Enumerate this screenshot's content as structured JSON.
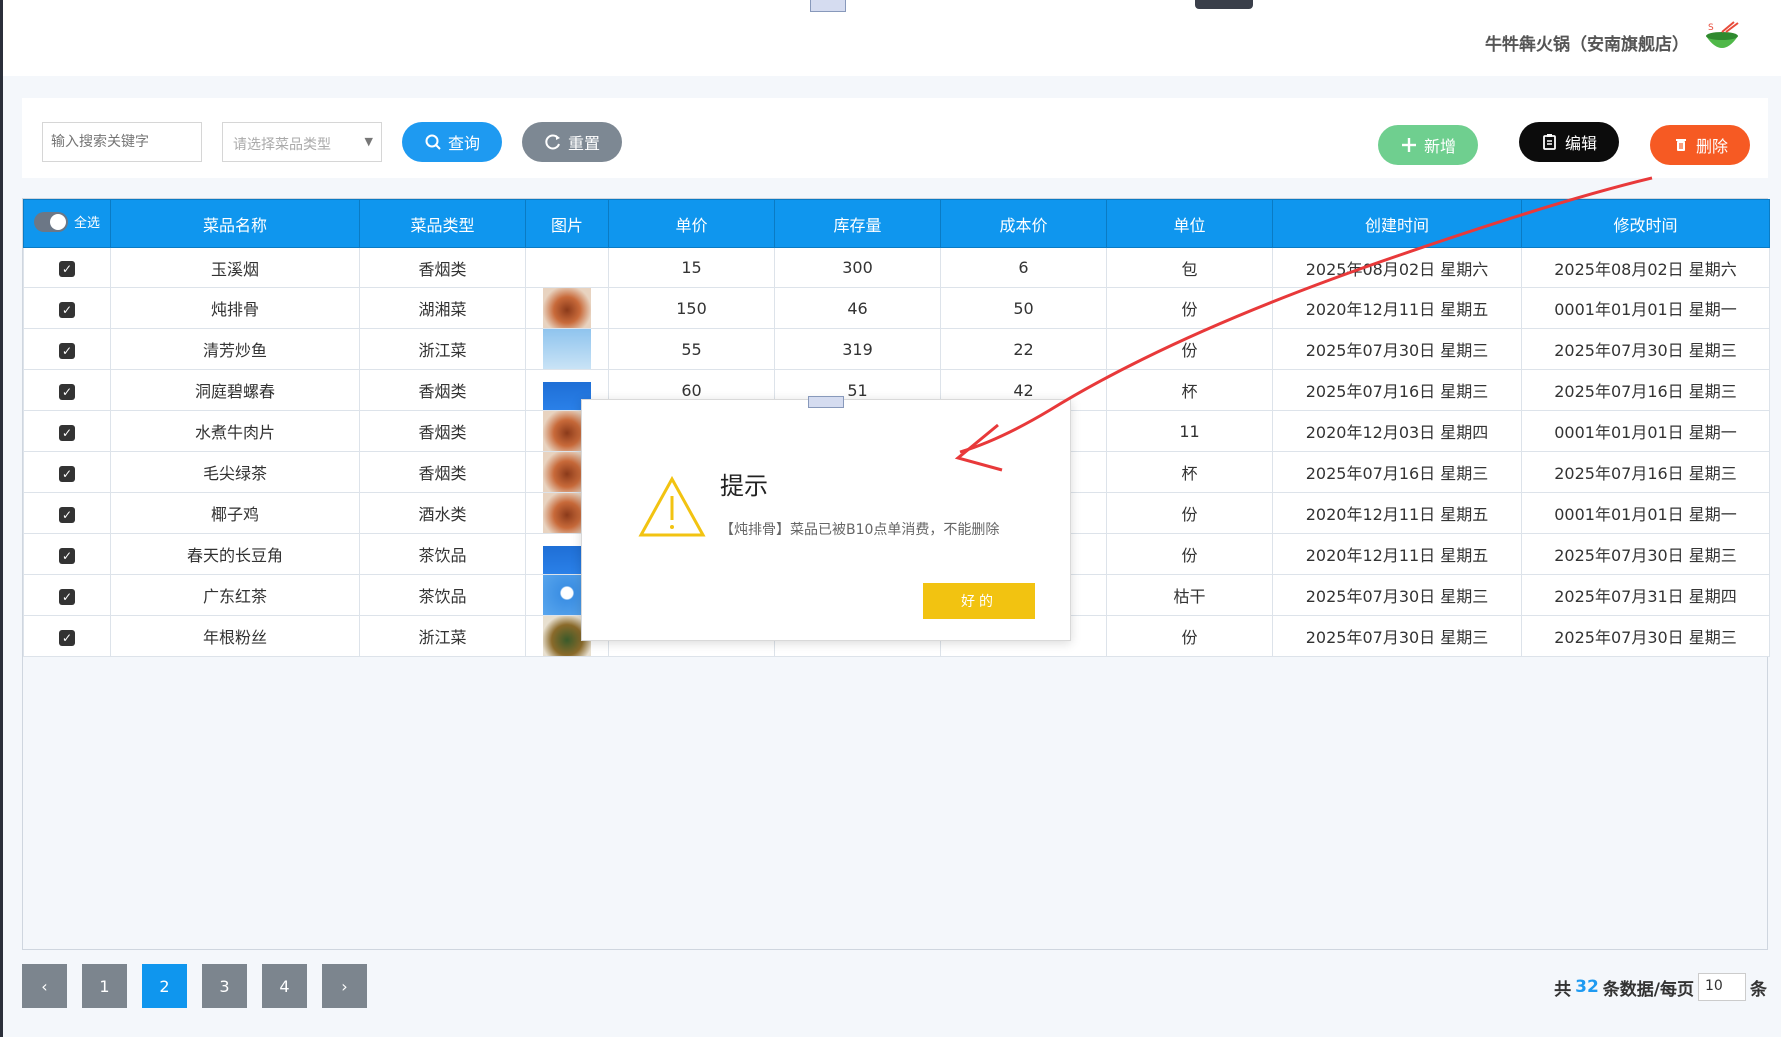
{
  "header": {
    "shop_name": "牛牪犇火锅（安南旗舰店）"
  },
  "toolbar": {
    "search_placeholder": "输入搜索关键字",
    "type_placeholder": "请选择菜品类型",
    "query_label": "查询",
    "reset_label": "重置",
    "add_label": "新增",
    "edit_label": "编辑",
    "delete_label": "删除"
  },
  "table": {
    "select_all_label": "全选",
    "columns": [
      "菜品名称",
      "菜品类型",
      "图片",
      "单价",
      "库存量",
      "成本价",
      "单位",
      "创建时间",
      "修改时间"
    ],
    "rows": [
      {
        "name": "玉溪烟",
        "type": "香烟类",
        "price": "15",
        "stock": "300",
        "cost": "6",
        "unit": "包",
        "created": "2025年08月02日 星期六",
        "modified": "2025年08月02日 星期六"
      },
      {
        "name": "炖排骨",
        "type": "湖湘菜",
        "price": "150",
        "stock": "46",
        "cost": "50",
        "unit": "份",
        "created": "2020年12月11日 星期五",
        "modified": "0001年01月01日 星期一"
      },
      {
        "name": "清芳炒鱼",
        "type": "浙江菜",
        "price": "55",
        "stock": "319",
        "cost": "22",
        "unit": "份",
        "created": "2025年07月30日 星期三",
        "modified": "2025年07月30日 星期三"
      },
      {
        "name": "洞庭碧螺春",
        "type": "香烟类",
        "price": "60",
        "stock": "51",
        "cost": "42",
        "unit": "杯",
        "created": "2025年07月16日 星期三",
        "modified": "2025年07月16日 星期三"
      },
      {
        "name": "水煮牛肉片",
        "type": "香烟类",
        "price": "",
        "stock": "",
        "cost": "",
        "unit": "11",
        "created": "2020年12月03日 星期四",
        "modified": "0001年01月01日 星期一"
      },
      {
        "name": "毛尖绿茶",
        "type": "香烟类",
        "price": "",
        "stock": "",
        "cost": "",
        "unit": "杯",
        "created": "2025年07月16日 星期三",
        "modified": "2025年07月16日 星期三"
      },
      {
        "name": "椰子鸡",
        "type": "酒水类",
        "price": "",
        "stock": "",
        "cost": "",
        "unit": "份",
        "created": "2020年12月11日 星期五",
        "modified": "0001年01月01日 星期一"
      },
      {
        "name": "春天的长豆角",
        "type": "茶饮品",
        "price": "",
        "stock": "",
        "cost": "",
        "unit": "份",
        "created": "2020年12月11日 星期五",
        "modified": "2025年07月30日 星期三"
      },
      {
        "name": "广东红茶",
        "type": "茶饮品",
        "price": "",
        "stock": "",
        "cost": "",
        "unit": "枯干",
        "created": "2025年07月30日 星期三",
        "modified": "2025年07月31日 星期四"
      },
      {
        "name": "年根粉丝",
        "type": "浙江菜",
        "price": "",
        "stock": "",
        "cost": "",
        "unit": "份",
        "created": "2025年07月30日 星期三",
        "modified": "2025年07月30日 星期三"
      }
    ]
  },
  "pagination": {
    "prev": "‹",
    "next": "›",
    "pages": [
      "1",
      "2",
      "3",
      "4"
    ],
    "current": "2",
    "total_prefix": "共",
    "total_count": "32",
    "total_suffix": "条数据/每页",
    "page_size": "10",
    "unit": "条"
  },
  "dialog": {
    "title": "提示",
    "message": "【炖排骨】菜品已被B10点单消费，不能删除",
    "ok_label": "好的"
  },
  "colors": {
    "primary": "#0f96ee",
    "delete": "#f65a23",
    "add": "#6fcf8f",
    "warn": "#f2c311",
    "annotation": "#e8393a"
  }
}
